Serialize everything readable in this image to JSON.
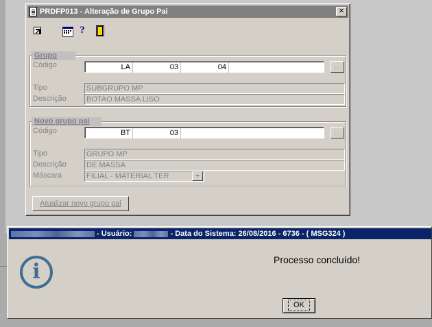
{
  "window": {
    "title": "PRDFP013 - Alteração de Grupo Pai",
    "close_label": "✕"
  },
  "toolbar": {
    "icons": [
      "exit-icon",
      "calendar-icon",
      "help-icon",
      "door-icon"
    ],
    "help_label": "?"
  },
  "grupo": {
    "legend": "Grupo",
    "codigo_label": "Código",
    "codigo_segments": [
      "LA",
      "03",
      "04"
    ],
    "tipo_label": "Tipo",
    "tipo_value": "SUBGRUPO MP",
    "descricao_label": "Descrição",
    "descricao_value": "BOTAO MASSA LISO",
    "lookup_label": "..."
  },
  "novo_grupo": {
    "legend": "Novo grupo pai",
    "codigo_label": "Código",
    "codigo_segments": [
      "BT",
      "03"
    ],
    "tipo_label": "Tipo",
    "tipo_value": "GRUPO MP",
    "descricao_label": "Descrição",
    "descricao_value": "DE MASSA",
    "mascara_label": "Máscara",
    "mascara_value": "FILIAL - MATERIAL TER",
    "lookup_label": "..."
  },
  "actions": {
    "atualizar_label": "Atualizar novo grupo pai"
  },
  "message": {
    "title_user": " - Usuário: ",
    "title_date": " - Data do Sistema: 26/08/2016 - 6736 - ( MSG324 )",
    "text": "Processo concluído!",
    "ok_label": "OK",
    "icon": "information-icon"
  },
  "colors": {
    "title_active": "#0a246a",
    "title_inactive": "#808080",
    "face": "#d4d0c8",
    "info_icon": "#3f6e95"
  }
}
